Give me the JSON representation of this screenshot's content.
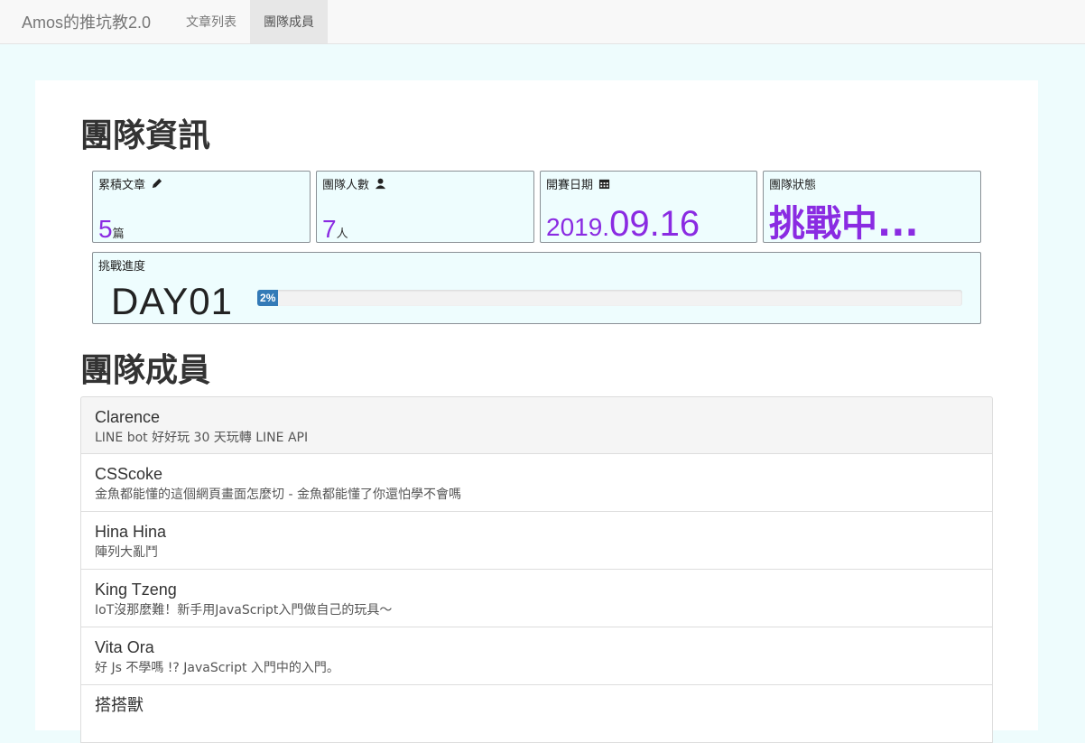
{
  "nav": {
    "brand": "Amos的推坑教2.0",
    "links": [
      "文章列表",
      "團隊成員"
    ]
  },
  "info": {
    "title": "團隊資訊",
    "articles": {
      "label": "累積文章",
      "value": "5",
      "unit": "篇",
      "icon": "pencil-icon"
    },
    "members": {
      "label": "團隊人數",
      "value": "7",
      "unit": "人",
      "icon": "user-icon"
    },
    "start_date": {
      "label": "開賽日期",
      "year": "2019.",
      "day": "09.16",
      "icon": "calendar-icon"
    },
    "status": {
      "label": "團隊狀態",
      "value": "挑戰中..."
    },
    "progress": {
      "label": "挑戰進度",
      "day": "DAY01",
      "percent_text": "2%",
      "percent": 2
    }
  },
  "members_section": {
    "title": "團隊成員",
    "items": [
      {
        "name": "Clarence",
        "desc": "LINE bot 好好玩 30 天玩轉 LINE API"
      },
      {
        "name": "CSScoke",
        "desc": "金魚都能懂的這個網頁畫面怎麼切 - 金魚都能懂了你還怕學不會嗎"
      },
      {
        "name": "Hina Hina",
        "desc": "陣列大亂鬥"
      },
      {
        "name": "King Tzeng",
        "desc": "IoT沒那麼難！新手用JavaScript入門做自己的玩具～"
      },
      {
        "name": "Vita Ora",
        "desc": "好 Js 不學嗎 !? JavaScript 入門中的入門。"
      },
      {
        "name": "搭搭獸",
        "desc": ""
      }
    ]
  },
  "colors": {
    "accent": "#8a2be2",
    "progress": "#337ab7",
    "page_bg": "#eefcfd"
  }
}
